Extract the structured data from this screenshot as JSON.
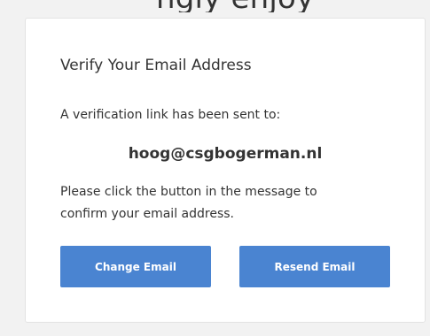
{
  "header": {
    "partial_text": "ngly enjoy"
  },
  "card": {
    "title": "Verify Your Email Address",
    "sent_text": "A verification link has been sent to:",
    "email": "hoog@csgbogerman.nl",
    "instructions": "Please click the button in the message to confirm your email address.",
    "change_email_label": "Change Email",
    "resend_email_label": "Resend Email"
  },
  "colors": {
    "button_bg": "#4a84d1",
    "button_text": "#ffffff",
    "card_bg": "#ffffff",
    "page_bg": "#f2f2f2"
  }
}
